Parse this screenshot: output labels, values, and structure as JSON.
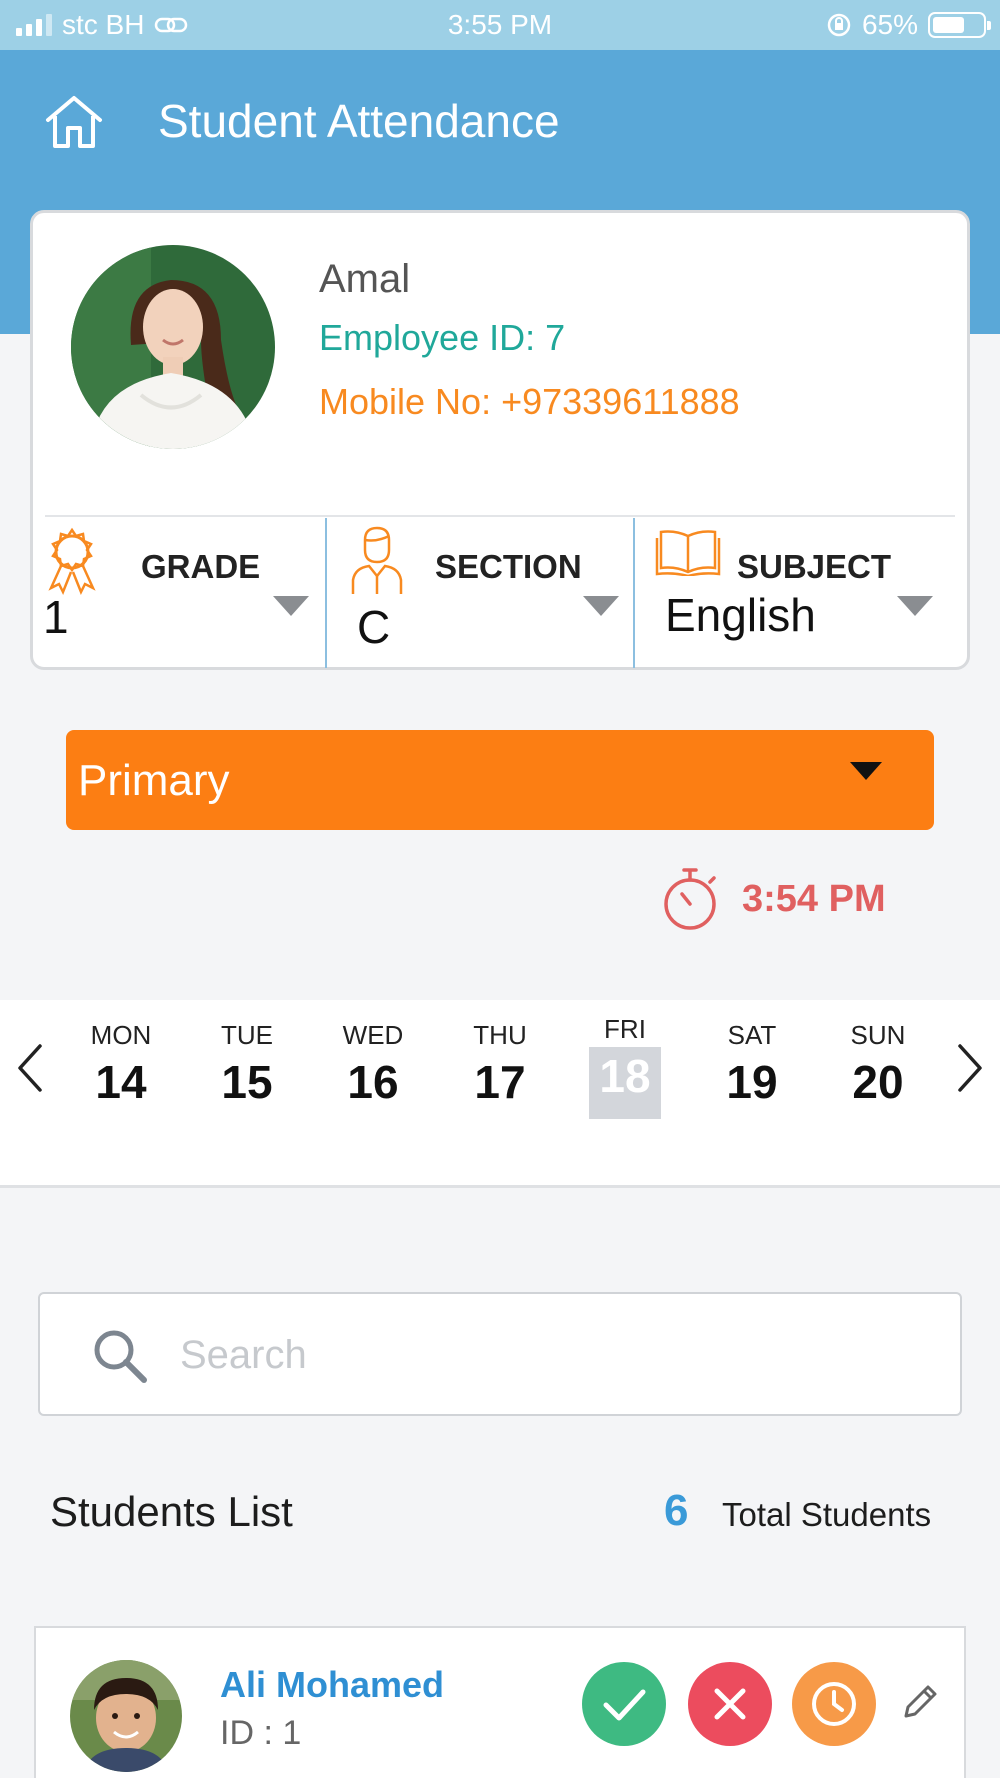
{
  "status_bar": {
    "carrier": "stc BH",
    "time": "3:55 PM",
    "battery": "65%",
    "battery_level": 0.65
  },
  "header": {
    "title": "Student Attendance"
  },
  "teacher": {
    "name": "Amal",
    "employee_id": "Employee ID: 7",
    "mobile": "Mobile No: +97339611888"
  },
  "selectors": {
    "grade": {
      "label": "GRADE",
      "value": "1"
    },
    "section": {
      "label": "SECTION",
      "value": "C"
    },
    "subject": {
      "label": "SUBJECT",
      "value": "English"
    }
  },
  "level": {
    "selected": "Primary"
  },
  "clock": {
    "time": "3:54 PM"
  },
  "week": {
    "days": [
      {
        "name": "MON",
        "num": "14"
      },
      {
        "name": "TUE",
        "num": "15"
      },
      {
        "name": "WED",
        "num": "16"
      },
      {
        "name": "THU",
        "num": "17"
      },
      {
        "name": "FRI",
        "num": "18"
      },
      {
        "name": "SAT",
        "num": "19"
      },
      {
        "name": "SUN",
        "num": "20"
      }
    ],
    "selected_index": 4
  },
  "search": {
    "placeholder": "Search"
  },
  "students": {
    "title": "Students List",
    "total_count": "6",
    "total_label": "Total Students",
    "items": [
      {
        "name": "Ali Mohamed",
        "id": "ID : 1"
      }
    ]
  },
  "colors": {
    "header": "#5aa8d8",
    "accent_orange": "#fc7e13",
    "teal": "#20a89a",
    "present": "#3eba82",
    "absent": "#ec4c5e",
    "late": "#f79a48",
    "clock_red": "#e06060",
    "link_blue": "#2f8fd3"
  }
}
